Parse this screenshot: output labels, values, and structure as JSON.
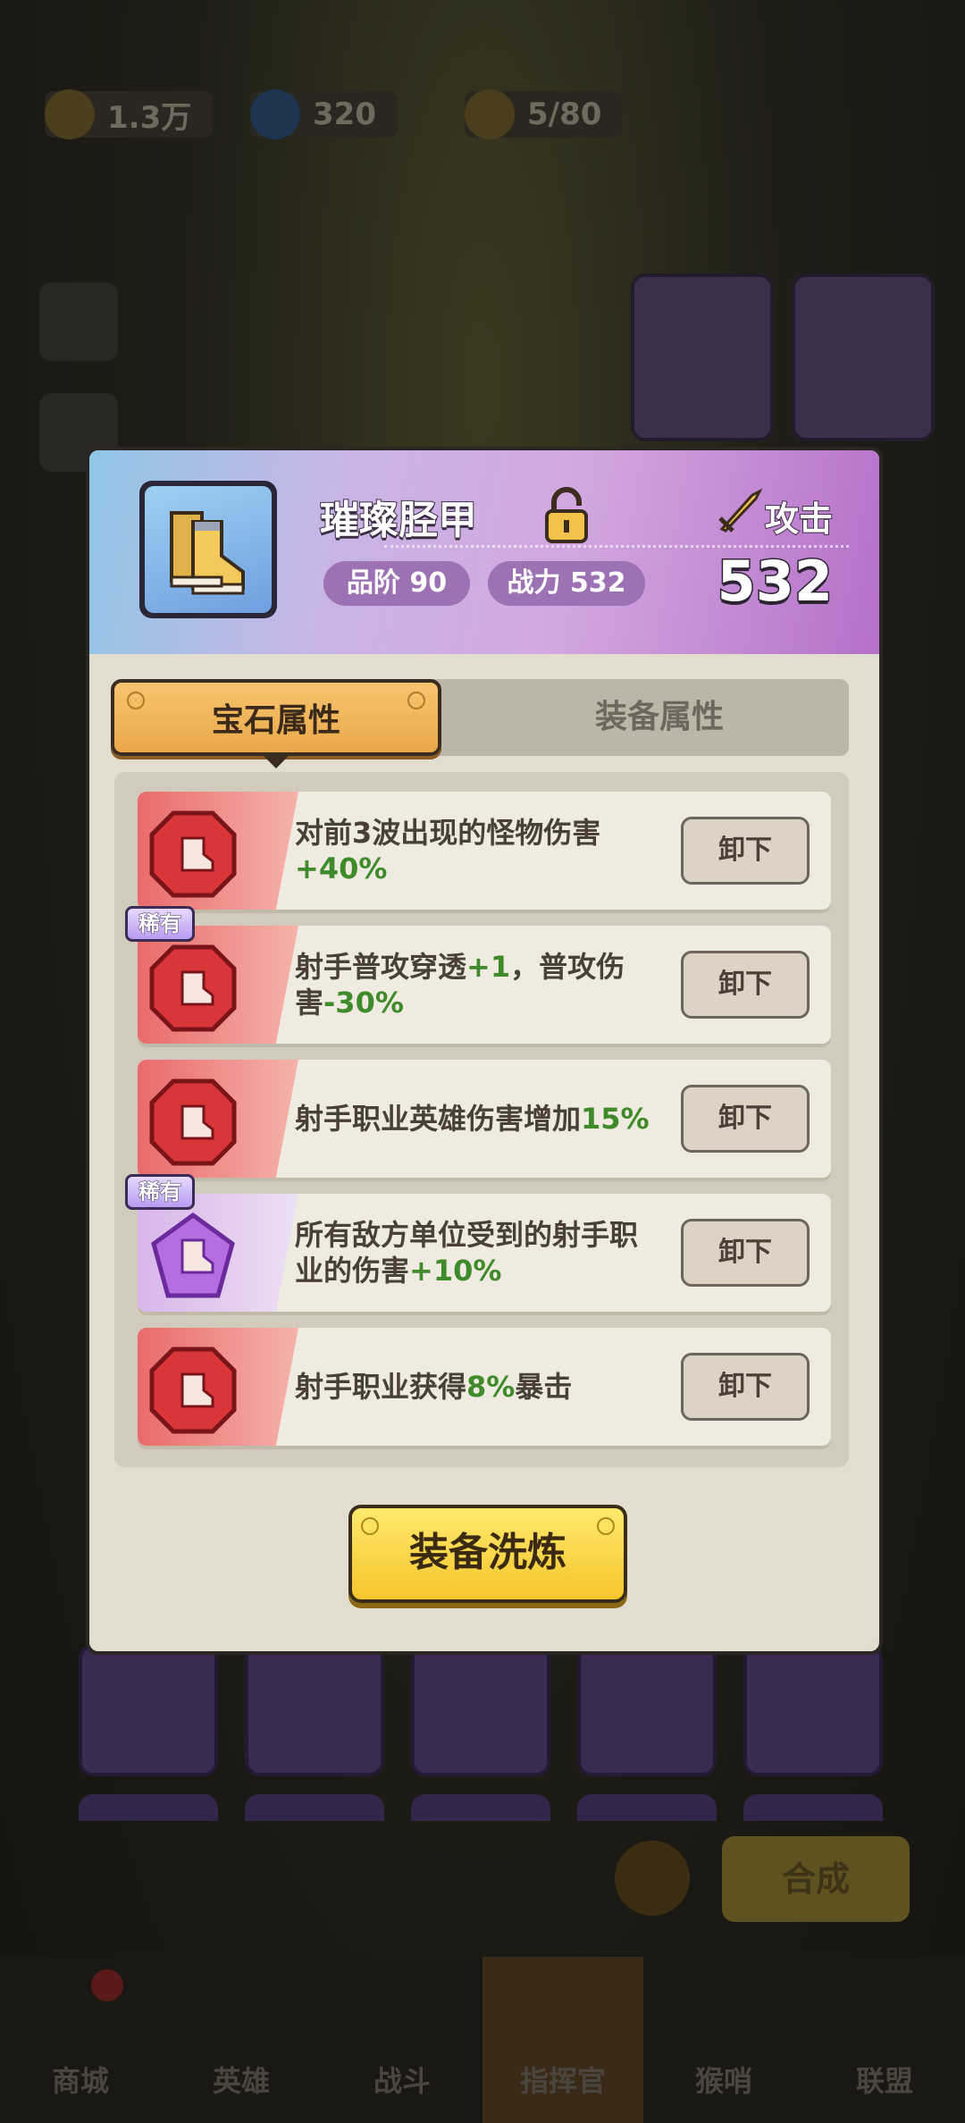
{
  "background": {
    "resources": [
      {
        "icon": "coin-icon",
        "value": "1.3万"
      },
      {
        "icon": "diamond-icon",
        "value": "320"
      },
      {
        "icon": "energy-icon",
        "value": "5/80"
      }
    ],
    "compose_button": "合成",
    "nav": [
      {
        "label": "商城"
      },
      {
        "label": "英雄"
      },
      {
        "label": "战斗"
      },
      {
        "label": "指挥官"
      },
      {
        "label": "猴哨"
      },
      {
        "label": "联盟"
      }
    ]
  },
  "item": {
    "name": "璀璨胫甲",
    "icon": "boots-icon",
    "grade_label": "品阶 90",
    "power_label": "战力 532",
    "stat_name": "攻击",
    "stat_value": "532"
  },
  "tabs": [
    {
      "label": "宝石属性",
      "active": true
    },
    {
      "label": "装备属性",
      "active": false
    }
  ],
  "gems": [
    {
      "color": "red",
      "rare": false,
      "text_a": "对前3波出现的怪物伤害",
      "hl_a": "+40%",
      "text_b": "",
      "hl_b": "",
      "button": "卸下"
    },
    {
      "color": "red",
      "rare": true,
      "rare_label": "稀有",
      "text_a": "射手普攻穿透",
      "hl_a": "+1",
      "text_b": "，普攻伤害",
      "hl_b": "-30%",
      "button": "卸下"
    },
    {
      "color": "red",
      "rare": false,
      "text_a": "射手职业英雄伤害增加",
      "hl_a": "15%",
      "text_b": "",
      "hl_b": "",
      "button": "卸下"
    },
    {
      "color": "purple",
      "rare": true,
      "rare_label": "稀有",
      "text_a": "所有敌方单位受到的射手职业的伤害",
      "hl_a": "+10%",
      "text_b": "",
      "hl_b": "",
      "button": "卸下"
    },
    {
      "color": "red",
      "rare": false,
      "text_a": "射手职业获得",
      "hl_a": "8%",
      "text_b": "暴击",
      "hl_b": "",
      "button": "卸下"
    }
  ],
  "refine_button": "装备洗炼",
  "colors": {
    "highlight": "#3f8a2a",
    "tab_active": "#eba74a",
    "refine": "#f6c52b"
  }
}
